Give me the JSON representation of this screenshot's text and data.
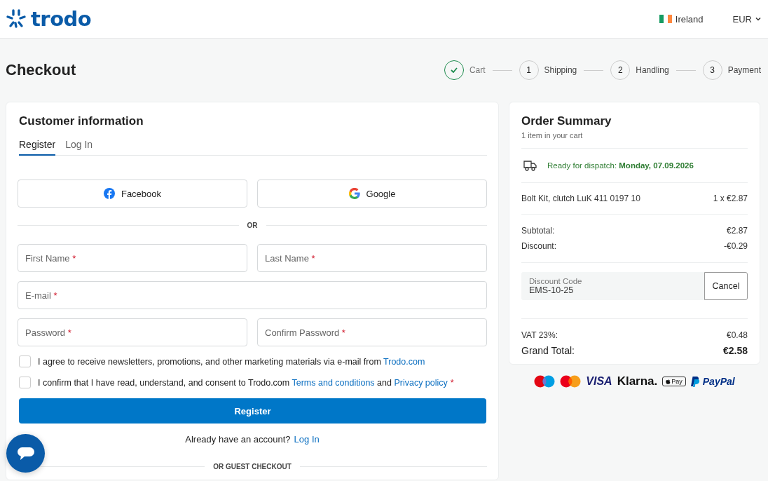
{
  "header": {
    "logo": "trodo",
    "country": "Ireland",
    "currency": "EUR"
  },
  "page_title": "Checkout",
  "steps": [
    {
      "label": "Cart",
      "completed": true
    },
    {
      "label": "Shipping",
      "number": "1",
      "completed": false
    },
    {
      "label": "Handling",
      "number": "2",
      "completed": false
    },
    {
      "label": "Payment",
      "number": "3",
      "completed": false
    }
  ],
  "customer": {
    "title": "Customer information",
    "tabs": [
      {
        "label": "Register",
        "selected": true
      },
      {
        "label": "Log In",
        "selected": false
      }
    ],
    "social_buttons": [
      {
        "kind": "facebook",
        "label": "Facebook"
      },
      {
        "kind": "google",
        "label": "Google"
      }
    ],
    "divider": "OR",
    "field_rows": [
      [
        {
          "label": "First Name",
          "required": true
        },
        {
          "label": "Last Name",
          "required": true
        }
      ],
      [
        {
          "label": "E-mail",
          "required": true
        }
      ],
      [
        {
          "label": "Password",
          "required": true
        },
        {
          "label": "Confirm Password",
          "required": true
        }
      ]
    ],
    "consents": [
      {
        "checked": false,
        "parts": [
          {
            "kind": "text",
            "text": "I agree to receive newsletters, promotions, and other marketing materials via e-mail from "
          },
          {
            "kind": "link",
            "text": "Trodo.com"
          }
        ]
      },
      {
        "checked": false,
        "parts": [
          {
            "kind": "text",
            "text": "I confirm that I have read, understand, and consent to Trodo.com "
          },
          {
            "kind": "link",
            "text": "Terms and conditions"
          },
          {
            "kind": "text",
            "text": " and "
          },
          {
            "kind": "link",
            "text": "Privacy policy"
          },
          {
            "kind": "required",
            "text": "*"
          }
        ]
      }
    ],
    "register_button": "Register",
    "login_prompt": {
      "text": "Already have an account?",
      "link": "Log In"
    },
    "guest_divider": "OR GUEST CHECKOUT"
  },
  "summary": {
    "title": "Order Summary",
    "subtitle": "1 item in your cart",
    "dispatch": "Ready for dispatch: **Monday, 07.09.2026**",
    "items": [
      {
        "name": "Bolt Kit, clutch LuK 411 0197 10",
        "price": "1 x €2.87"
      }
    ],
    "totals": [
      {
        "label": "Subtotal:",
        "value": "€2.87"
      },
      {
        "label": "Discount:",
        "value": "-€0.29"
      }
    ],
    "discount_code": {
      "label": "Discount Code",
      "value": "EMS-10-25",
      "button": "Cancel"
    },
    "vat": {
      "label": "VAT 23%:",
      "value": "€0.48"
    },
    "grand_total": {
      "label": "Grand Total:",
      "value": "€2.58"
    }
  },
  "payment_methods": [
    {
      "kind": "maestro"
    },
    {
      "kind": "mastercard"
    },
    {
      "kind": "visa",
      "text": "VISA"
    },
    {
      "kind": "klarna",
      "text": "Klarna."
    },
    {
      "kind": "applepay",
      "text": "Pay"
    },
    {
      "kind": "paypal",
      "text": "PayPal"
    }
  ]
}
